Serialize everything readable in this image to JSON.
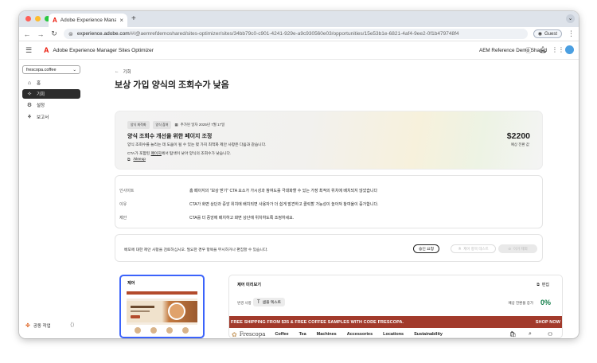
{
  "colors": {
    "accent": "#3b63fb",
    "adobe_red": "#eb1000",
    "promo_bg": "#a23a2b",
    "success": "#16804c",
    "active_nav": "#2c2c2c"
  },
  "browser": {
    "tab_title": "Adobe Experience Manager S",
    "tab_close_icon": "close-icon",
    "new_tab_label": "+",
    "url_host": "experience.adobe.com",
    "url_path": "/#/@aemrefdemoshared/sites-optimizer/sites/34bb79c0-c901-4241-929e-a9c930560e03/opportunities/15e53b1e-6821-4af4-9ee2-0f1b479748f4",
    "guest_label": "Guest"
  },
  "app": {
    "title": "Adobe Experience Manager Sites Optimizer",
    "org_name": "AEM Reference Demo Shared"
  },
  "sidebar": {
    "site_selector": "frescopa.coffee",
    "items": [
      {
        "label": "홈",
        "icon": "home-icon"
      },
      {
        "label": "기회",
        "icon": "opportunity-icon"
      },
      {
        "label": "설정",
        "icon": "gear-icon"
      },
      {
        "label": "보고서",
        "icon": "report-icon"
      }
    ],
    "collab_label": "공동 작업"
  },
  "main": {
    "back_label": "기회",
    "page_title": "보상 가입 양식의 조회수가 낮음",
    "hero": {
      "chip1": "양식 최적화",
      "chip2": "양식 참여",
      "date_text": "추가된 일자 2025년 7월 17일",
      "title": "양식 조회수 개선을 위한 페이지 조정",
      "desc": "양식 조회수를 늘리는 데 도움이 될 수 있는 몇 가지 최적화 제안 사항은 다음과 같습니다.",
      "desc2_pre": "CTA가 포함된 ",
      "desc2_link": "페이지",
      "desc2_post": "에서 탐색이 낮아 양식의 조회수가 낮습니다.",
      "link_text": "/sleeup",
      "price": "$2200",
      "price_label": "예상 전환 값"
    },
    "info": [
      {
        "label": "인사이트",
        "value": "홈 페이지의 \"보상 받기\" CTA 요소가 가시성과 참여도를 극대화할 수 있는 가장 최적의 위치에 배치되지 않았습니다"
      },
      {
        "label": "이유",
        "value": "CTA가 화면 상단과 중앙 위치에 배치되면 사용자가 더 쉽게 발견하고 클릭할 가능성이 높아져 참여율이 증가합니다."
      },
      {
        "label": "제안",
        "value": "CTA를 더 중앙에 배치하고 화면 상단에 위치하도록 조정하세요."
      }
    ],
    "review": {
      "text": "배포에 대한 제안 사항을 검토하십시오. 필요한 경우 항목을 무시하거나 편집할 수 있습니다.",
      "approve": "승인 요청",
      "ab_test": "제어 항목 테스트",
      "ignore": "이거 제외"
    },
    "control": {
      "label": "제어"
    },
    "preview": {
      "title": "제어 미리보기",
      "edit": "편집",
      "change_label": "변경 사항",
      "chip_label": "샘플 텍스트",
      "conversion_label": "예상 전환율 증가",
      "conversion_value": "0%",
      "promo_text": "FREE SHIPPING FROM $35 & FREE COFFEE SAMPLES WITH CODE FRESCOPA.",
      "shop_now": "SHOP NOW",
      "site_logo": "Frescopa",
      "nav": [
        "Coffee",
        "Tea",
        "Machines",
        "Accessories",
        "Locations",
        "Sustainability"
      ]
    }
  }
}
